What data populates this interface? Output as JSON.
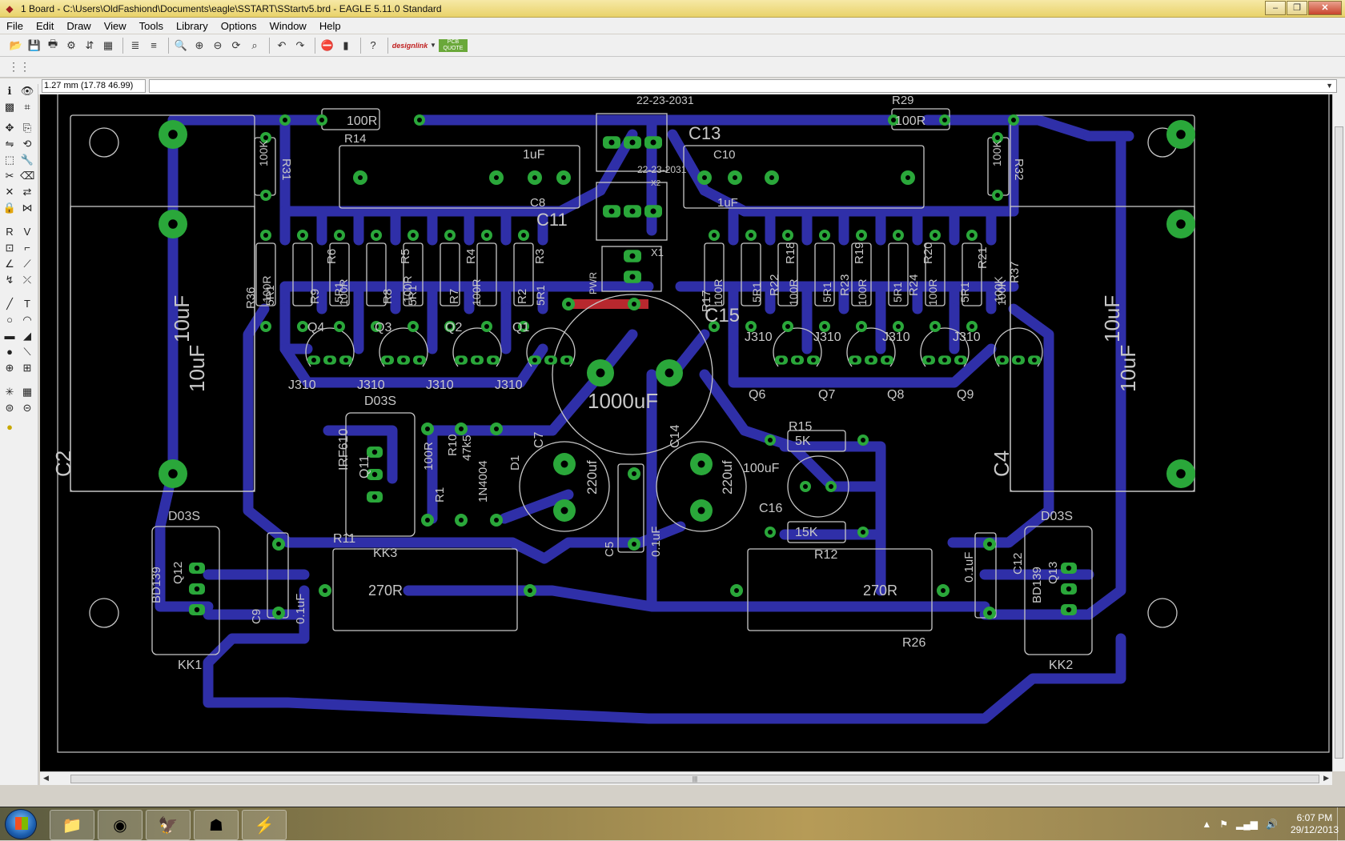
{
  "window": {
    "title": "1 Board - C:\\Users\\OldFashiond\\Documents\\eagle\\SSTART\\SStartv5.brd - EAGLE 5.11.0 Standard"
  },
  "menu": [
    "File",
    "Edit",
    "Draw",
    "View",
    "Tools",
    "Library",
    "Options",
    "Window",
    "Help"
  ],
  "toolbar": {
    "designlink": "designlink",
    "pcbquote": "PCB QUOTE"
  },
  "coords": "1.27 mm (17.78 46.99)",
  "board": {
    "labels": [
      {
        "t": "22-23-2031"
      },
      {
        "t": "22-23-2031"
      },
      {
        "t": "100R"
      },
      {
        "t": "R14"
      },
      {
        "t": "R31"
      },
      {
        "t": "100K"
      },
      {
        "t": "R29"
      },
      {
        "t": "100R"
      },
      {
        "t": "R32"
      },
      {
        "t": "100K"
      },
      {
        "t": "C13"
      },
      {
        "t": "1uF"
      },
      {
        "t": "C8"
      },
      {
        "t": "C10"
      },
      {
        "t": "1uF"
      },
      {
        "t": "C11"
      },
      {
        "t": "X2"
      },
      {
        "t": "X1"
      },
      {
        "t": "PWR"
      },
      {
        "t": "R36"
      },
      {
        "t": "R9"
      },
      {
        "t": "R6"
      },
      {
        "t": "R8"
      },
      {
        "t": "R5"
      },
      {
        "t": "R7"
      },
      {
        "t": "R4"
      },
      {
        "t": "R2"
      },
      {
        "t": "R3"
      },
      {
        "t": "R17"
      },
      {
        "t": "R22"
      },
      {
        "t": "R18"
      },
      {
        "t": "R23"
      },
      {
        "t": "R19"
      },
      {
        "t": "R24"
      },
      {
        "t": "R20"
      },
      {
        "t": "R21"
      },
      {
        "t": "R37"
      },
      {
        "t": "Q4"
      },
      {
        "t": "Q3"
      },
      {
        "t": "Q2"
      },
      {
        "t": "Q1"
      },
      {
        "t": "J310"
      },
      {
        "t": "J310"
      },
      {
        "t": "J310"
      },
      {
        "t": "J310"
      },
      {
        "t": "C15"
      },
      {
        "t": "J310"
      },
      {
        "t": "J310"
      },
      {
        "t": "J310"
      },
      {
        "t": "J310"
      },
      {
        "t": "Q6"
      },
      {
        "t": "Q7"
      },
      {
        "t": "Q8"
      },
      {
        "t": "Q9"
      },
      {
        "t": "1000uF"
      },
      {
        "t": "D03S"
      },
      {
        "t": "IRF610"
      },
      {
        "t": "Q11"
      },
      {
        "t": "R1"
      },
      {
        "t": "R10"
      },
      {
        "t": "47k5"
      },
      {
        "t": "100R"
      },
      {
        "t": "1N4004"
      },
      {
        "t": "D1"
      },
      {
        "t": "C7"
      },
      {
        "t": "220uf"
      },
      {
        "t": "C14"
      },
      {
        "t": "220uf"
      },
      {
        "t": "R15"
      },
      {
        "t": "5K"
      },
      {
        "t": "100uF"
      },
      {
        "t": "C16"
      },
      {
        "t": "15K"
      },
      {
        "t": "R12"
      },
      {
        "t": "10uF"
      },
      {
        "t": "10uF"
      },
      {
        "t": "C2"
      },
      {
        "t": "10uF"
      },
      {
        "t": "10uF"
      },
      {
        "t": "C4"
      },
      {
        "t": "D03S"
      },
      {
        "t": "BD139"
      },
      {
        "t": "Q12"
      },
      {
        "t": "C9"
      },
      {
        "t": "0.1uF"
      },
      {
        "t": "R11"
      },
      {
        "t": "KK3"
      },
      {
        "t": "270R"
      },
      {
        "t": "C5"
      },
      {
        "t": "0.1uF"
      },
      {
        "t": "270R"
      },
      {
        "t": "R26"
      },
      {
        "t": "0.1uF"
      },
      {
        "t": "C12"
      },
      {
        "t": "BD139"
      },
      {
        "t": "Q13"
      },
      {
        "t": "D03S"
      },
      {
        "t": "KK1"
      },
      {
        "t": "KK2"
      },
      {
        "t": "5R1"
      },
      {
        "t": "100R"
      },
      {
        "t": "5R1"
      },
      {
        "t": "100R"
      },
      {
        "t": "5R1"
      },
      {
        "t": "100R"
      },
      {
        "t": "5R1"
      },
      {
        "t": "100R"
      },
      {
        "t": "100K"
      },
      {
        "t": "100R"
      },
      {
        "t": "5R1"
      },
      {
        "t": "100R"
      },
      {
        "t": "5R1"
      },
      {
        "t": "100R"
      },
      {
        "t": "5R1"
      },
      {
        "t": "100R"
      },
      {
        "t": "5R1"
      },
      {
        "t": "100K"
      }
    ]
  },
  "taskbar": {
    "time": "6:07 PM",
    "date": "29/12/2013"
  },
  "colors": {
    "trace": "#2f2fa8",
    "pad": "#2aa73a",
    "outline": "#c8c8c8",
    "canvas": "#000000"
  }
}
